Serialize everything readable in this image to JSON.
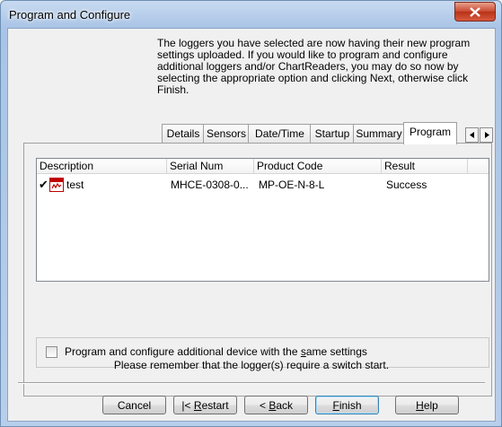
{
  "window": {
    "title": "Program and Configure",
    "close_glyph": "✕"
  },
  "intro_text": "The loggers you have selected are now having their new program settings uploaded. If you would like to program and configure additional loggers and/or ChartReaders, you may do so now by selecting the appropriate option and clicking Next, otherwise click Finish.",
  "tabs": [
    {
      "label": "Details"
    },
    {
      "label": "Sensors"
    },
    {
      "label": "Date/Time"
    },
    {
      "label": "Startup"
    },
    {
      "label": "Summary"
    },
    {
      "label": "Program"
    }
  ],
  "active_tab": "Program",
  "tab_scroll": {
    "left": "◂",
    "right": "▸"
  },
  "table": {
    "columns": [
      "Description",
      "Serial Num",
      "Product Code",
      "Result"
    ],
    "rows": [
      {
        "check": "✔",
        "icon": "logger-device-icon",
        "description": "test",
        "serial": "MHCE-0308-0...",
        "product_code": "MP-OE-N-8-L",
        "result": "Success"
      }
    ]
  },
  "option": {
    "label_pre": "Program and configure additional device with the ",
    "label_accel": "s",
    "label_post": "ame settings",
    "checked": false
  },
  "reminder": "Please remember that the logger(s) require a switch start.",
  "buttons": {
    "cancel": "Cancel",
    "restart_pre": "|< ",
    "restart_accel": "R",
    "restart_post": "estart",
    "back_pre": "< ",
    "back_accel": "B",
    "back_post": "ack",
    "finish_accel": "F",
    "finish_post": "inish",
    "help_accel": "H",
    "help_post": "elp"
  }
}
